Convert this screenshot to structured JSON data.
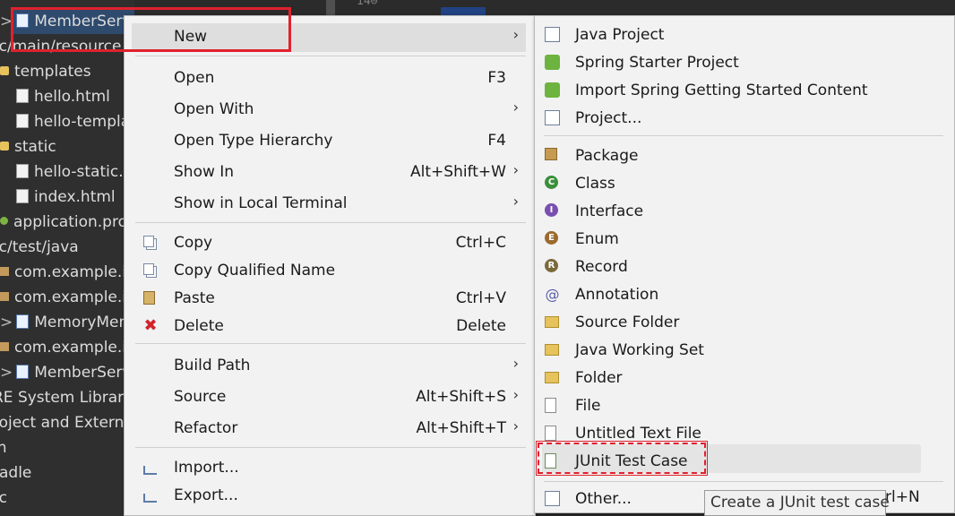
{
  "explorer": {
    "rows": [
      {
        "label": "MemberServ",
        "icon": "java-file-icon"
      },
      {
        "label": "rc/main/resource",
        "icon": ""
      },
      {
        "label": "templates",
        "icon": "folder-icon"
      },
      {
        "label": "hello.html",
        "icon": "file-icon"
      },
      {
        "label": "hello-templa",
        "icon": "file-icon"
      },
      {
        "label": "static",
        "icon": "folder-icon"
      },
      {
        "label": "hello-static.h",
        "icon": "file-icon"
      },
      {
        "label": "index.html",
        "icon": "file-icon"
      },
      {
        "label": "application.prop",
        "icon": "properties-icon"
      },
      {
        "label": "rc/test/java",
        "icon": ""
      },
      {
        "label": "com.example.in",
        "icon": "package-icon"
      },
      {
        "label": "com.example.in",
        "icon": "package-icon"
      },
      {
        "label": "MemoryMem",
        "icon": "java-file-icon"
      },
      {
        "label": "com.example.in",
        "icon": "package-icon"
      },
      {
        "label": "MemberServ",
        "icon": "java-file-icon"
      },
      {
        "label": "RE System Library",
        "icon": ""
      },
      {
        "label": "roject and Extern",
        "icon": ""
      },
      {
        "label": "in",
        "icon": ""
      },
      {
        "label": "radle",
        "icon": ""
      },
      {
        "label": "rc",
        "icon": ""
      }
    ]
  },
  "editor": {
    "line_text": "14⊖"
  },
  "context_menu": {
    "new_label": "New",
    "open_label": "Open",
    "open_shortcut": "F3",
    "open_with_label": "Open With",
    "open_type_hierarchy_label": "Open Type Hierarchy",
    "open_type_hierarchy_shortcut": "F4",
    "show_in_label": "Show In",
    "show_in_shortcut": "Alt+Shift+W",
    "show_in_terminal_label": "Show in Local Terminal",
    "copy_label": "Copy",
    "copy_shortcut": "Ctrl+C",
    "copy_qualified_label": "Copy Qualified Name",
    "paste_label": "Paste",
    "paste_shortcut": "Ctrl+V",
    "delete_label": "Delete",
    "delete_shortcut": "Delete",
    "build_path_label": "Build Path",
    "source_label": "Source",
    "source_shortcut": "Alt+Shift+S",
    "refactor_label": "Refactor",
    "refactor_shortcut": "Alt+Shift+T",
    "import_label": "Import...",
    "export_label": "Export..."
  },
  "new_menu": {
    "items": [
      {
        "label": "Java Project",
        "icon": "java-project-icon"
      },
      {
        "label": "Spring Starter Project",
        "icon": "spring-starter-icon"
      },
      {
        "label": "Import Spring Getting Started Content",
        "icon": "spring-import-icon"
      },
      {
        "label": "Project...",
        "icon": "project-icon"
      },
      {
        "label": "Package",
        "icon": "package-icon"
      },
      {
        "label": "Class",
        "icon": "class-icon"
      },
      {
        "label": "Interface",
        "icon": "interface-icon"
      },
      {
        "label": "Enum",
        "icon": "enum-icon"
      },
      {
        "label": "Record",
        "icon": "record-icon"
      },
      {
        "label": "Annotation",
        "icon": "annotation-icon"
      },
      {
        "label": "Source Folder",
        "icon": "source-folder-icon"
      },
      {
        "label": "Java Working Set",
        "icon": "working-set-icon"
      },
      {
        "label": "Folder",
        "icon": "folder-icon"
      },
      {
        "label": "File",
        "icon": "file-icon"
      },
      {
        "label": "Untitled Text File",
        "icon": "text-file-icon"
      },
      {
        "label": "JUnit Test Case",
        "icon": "junit-test-icon"
      },
      {
        "label": "Other...",
        "icon": "other-wizard-icon"
      }
    ],
    "other_shortcut_tail": "rl+N"
  },
  "tooltip": {
    "text": "Create a JUnit test case"
  },
  "colors": {
    "highlight_red": "#e0212e",
    "menu_bg": "#f2f2f2",
    "dark_bg": "#2f2f2f"
  }
}
